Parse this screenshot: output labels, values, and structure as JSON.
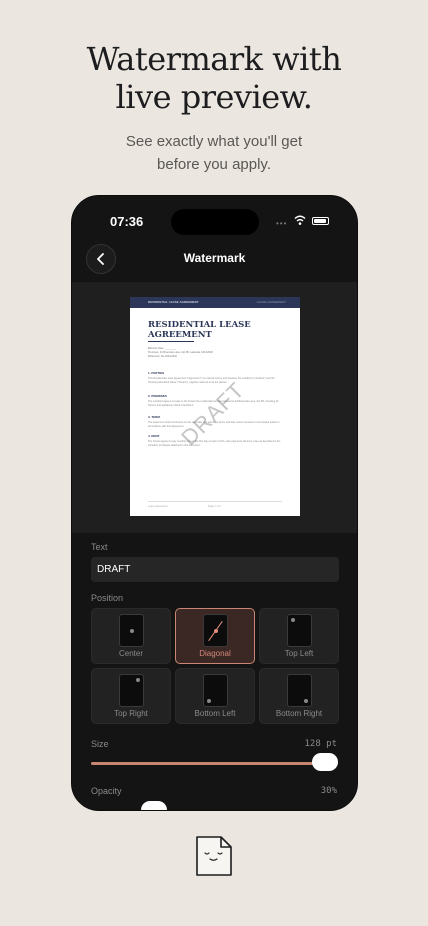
{
  "marketing": {
    "headline_line1": "Watermark with",
    "headline_line2": "live preview.",
    "subhead_line1": "See exactly what you'll get",
    "subhead_line2": "before you apply."
  },
  "status_bar": {
    "time": "07:36",
    "signal": "•••"
  },
  "nav": {
    "title": "Watermark",
    "back_icon": "chevron-left-icon"
  },
  "document": {
    "header_left": "RESIDENTIAL LEASE AGREEMENT",
    "header_right": "LEASE AGREEMENT",
    "title_line1": "RESIDENTIAL LEASE",
    "title_line2": "AGREEMENT",
    "meta_line1": "Effective Date: ________",
    "meta_line2": "Premises: 44 Riverside Lane, Apt 3B, Lakeside, MA 02000",
    "meta_line3": "Reference: RL-2024-0042",
    "s1_title": "1. PARTIES",
    "s1_text": "This Residential Lease Agreement (\"Agreement\") is entered into by and between the Landlord (\"Landlord\") and the Tenant(s) identified below (\"Tenant\"), together referred to as the parties.",
    "s2_title": "2. PREMISES",
    "s2_text": "The Landlord agrees to lease to the Tenant the residential premises located at 44 Riverside Lane, Apt 3B, including all fixtures and appliances listed in Exhibit A.",
    "s3_title": "3. TERM",
    "s3_text": "The lease term shall commence on the start date and terminate at the end date unless renewed or terminated earlier in accordance with this Agreement.",
    "s4_title": "4. RENT",
    "s4_text": "The Tenant agrees to pay monthly rent on the first day of each month. Late payments will incur a fee as described in the schedule of charges attached to this document.",
    "footer_left": "Lease Agreement",
    "footer_center": "Page 1 of 4",
    "watermark_text": "DRAFT"
  },
  "controls": {
    "text_label": "Text",
    "text_value": "DRAFT",
    "position_label": "Position",
    "positions": [
      {
        "label": "Center"
      },
      {
        "label": "Diagonal"
      },
      {
        "label": "Top Left"
      },
      {
        "label": "Top Right"
      },
      {
        "label": "Bottom Left"
      },
      {
        "label": "Bottom Right"
      }
    ],
    "selected_position": "Diagonal",
    "size_label": "Size",
    "size_value": "128 pt",
    "size_fraction": 0.96,
    "opacity_label": "Opacity",
    "opacity_value": "30%",
    "opacity_fraction": 0.3
  },
  "colors": {
    "accent": "#c98673",
    "background": "#ebe7e0",
    "panel": "#141414",
    "doc_navy": "#2b3658"
  }
}
